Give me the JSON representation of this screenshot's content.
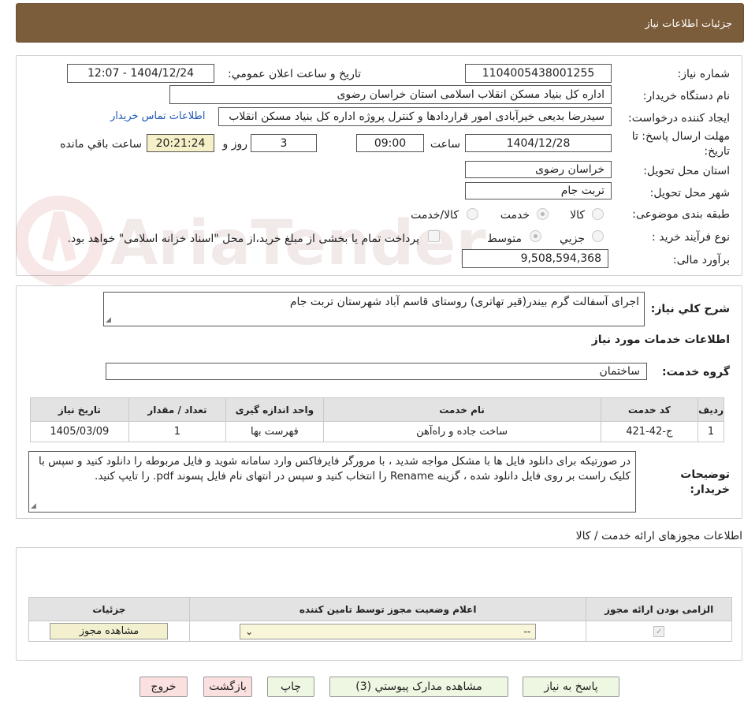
{
  "header": {
    "title": "جزئیات اطلاعات نیاز"
  },
  "form": {
    "need_number_label": "شماره نیاز:",
    "need_number": "1104005438001255",
    "announce_label": "تاریخ و ساعت اعلان عمومي:",
    "announce_value": "1404/12/24 - 12:07",
    "buyer_org_label": "نام دستگاه خريدار:",
    "buyer_org": "اداره کل بنیاد مسکن انقلاب اسلامی استان خراسان رضوی",
    "creator_label": "ايجاد کننده درخواست:",
    "creator": "سیدرضا بدیعی خیرآبادی امور قراردادها و کنترل پروژه اداره کل بنیاد مسکن انقلاب",
    "contact_link": "اطلاعات تماس خريدار",
    "deadline_label_1": "مهلت ارسال پاسخ: تا",
    "deadline_label_2": "تاريخ:",
    "deadline_date": "1404/12/28",
    "time_label": "ساعت",
    "deadline_time": "09:00",
    "days_value": "3",
    "days_label": "روز و",
    "remaining_time": "20:21:24",
    "remaining_label": "ساعت باقي مانده",
    "province_label": "استان محل تحويل:",
    "province": "خراسان رضوی",
    "city_label": "شهر محل تحويل:",
    "city": "تربت جام",
    "category_label": "طبقه بندی موضوعی:",
    "category_options": [
      "کالا",
      "خدمت",
      "کالا/خدمت"
    ],
    "category_selected": "خدمت",
    "process_label": "نوع فرآيند خريد :",
    "process_options": [
      "جزيي",
      "متوسط"
    ],
    "process_selected": "متوسط",
    "payment_note": "پرداخت تمام يا بخشی از مبلغ خريد،از محل \"اسناد خزانه اسلامی\" خواهد بود.",
    "budget_label": "برآورد مالی:",
    "budget": "9,508,594,368"
  },
  "description": {
    "label": "شرح کلي نياز:",
    "text": "اجرای آسفالت گرم بیندر(قیر تهاتری) روستای قاسم آباد شهرستان تربت جام"
  },
  "services": {
    "section_title": "اطلاعات خدمات مورد نياز",
    "group_label": "گروه خدمت:",
    "group_value": "ساختمان",
    "columns": [
      "رديف",
      "کد خدمت",
      "نام خدمت",
      "واحد اندازه گيری",
      "تعداد / مقدار",
      "تاريخ نياز"
    ],
    "rows": [
      [
        "1",
        "ج-42-421",
        "ساخت جاده و راه‌آهن",
        "فهرست بها",
        "1",
        "1405/03/09"
      ]
    ]
  },
  "buyer_notes": {
    "label_1": "توضيحات",
    "label_2": "خريدار:",
    "text": "در صورتیکه برای دانلود فایل ها با مشکل مواجه شدید ، با مرورگر فایرفاکس وارد سامانه شوید و فایل مربوطه را دانلود کنید و سپس با کلیک راست بر روی فایل دانلود شده ، گزینه Rename را انتخاب کنید و سپس در انتهای نام فایل پسوند pdf. را تایپ کنید."
  },
  "permits": {
    "section_title": "اطلاعات مجوزهای ارائه خدمت / کالا",
    "columns": [
      "الزامی بودن ارائه مجوز",
      "اعلام وضعيت مجوز توسط تامين کننده",
      "جزئيات"
    ],
    "select_value": "--",
    "view_button": "مشاهده مجوز"
  },
  "footer": {
    "reply": "پاسخ به نياز",
    "attachments": "مشاهده مدارک پيوستي (3)",
    "print": "چاپ",
    "back": "بازگشت",
    "exit": "خروج"
  },
  "watermark": {
    "text": "AriaTender.net"
  }
}
